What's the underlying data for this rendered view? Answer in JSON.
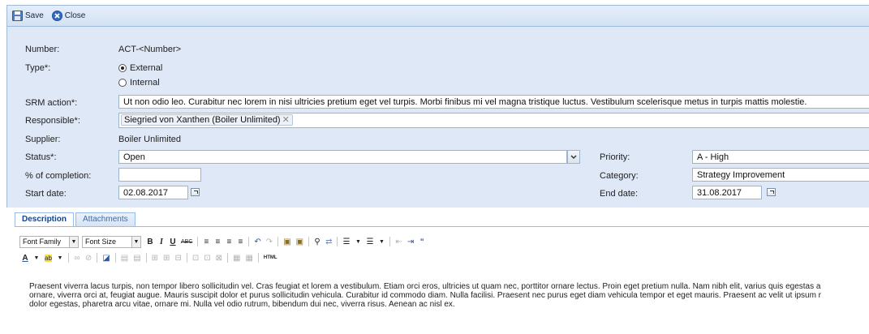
{
  "toolbar": {
    "save_label": "Save",
    "close_label": "Close"
  },
  "form": {
    "number_label": "Number:",
    "number_value": "ACT-<Number>",
    "type_label": "Type*:",
    "type_options": [
      "External",
      "Internal"
    ],
    "type_selected": "External",
    "srm_label": "SRM action*:",
    "srm_value": "Ut non odio leo. Curabitur nec lorem in nisi ultricies pretium eget vel turpis. Morbi finibus mi vel magna tristique luctus. Vestibulum scelerisque metus in turpis mattis molestie.",
    "responsible_label": "Responsible*:",
    "responsible_value": "Siegried von Xanthen (Boiler Unlimited)",
    "supplier_label": "Supplier:",
    "supplier_value": "Boiler Unlimited",
    "status_label": "Status*:",
    "status_value": "Open",
    "completion_label": "% of completion:",
    "completion_value": "",
    "start_label": "Start date:",
    "start_value": "02.08.2017",
    "priority_label": "Priority:",
    "priority_value": "A - High",
    "category_label": "Category:",
    "category_value": "Strategy Improvement",
    "end_label": "End date:",
    "end_value": "31.08.2017"
  },
  "tabs": [
    "Description",
    "Attachments"
  ],
  "editor": {
    "font_family": "Font Family",
    "font_size": "Font Size",
    "html_label": "HTML",
    "content_lines": [
      "Praesent viverra lacus turpis, non tempor libero sollicitudin vel. Cras feugiat et lorem a vestibulum. Etiam orci eros, ultricies ut quam nec, porttitor ornare lectus. Proin eget pretium nulla. Nam nibh elit, varius quis egestas a",
      "ornare, viverra orci at, feugiat augue. Mauris suscipit dolor et purus sollicitudin vehicula. Curabitur id commodo diam. Nulla facilisi. Praesent nec purus eget diam vehicula tempor et eget mauris. Praesent ac velit ut ipsum r",
      "dolor egestas, pharetra arcu vitae, ornare mi. Nulla vel odio rutrum, bibendum dui nec, viverra risus. Aenean ac nisl ex."
    ]
  }
}
